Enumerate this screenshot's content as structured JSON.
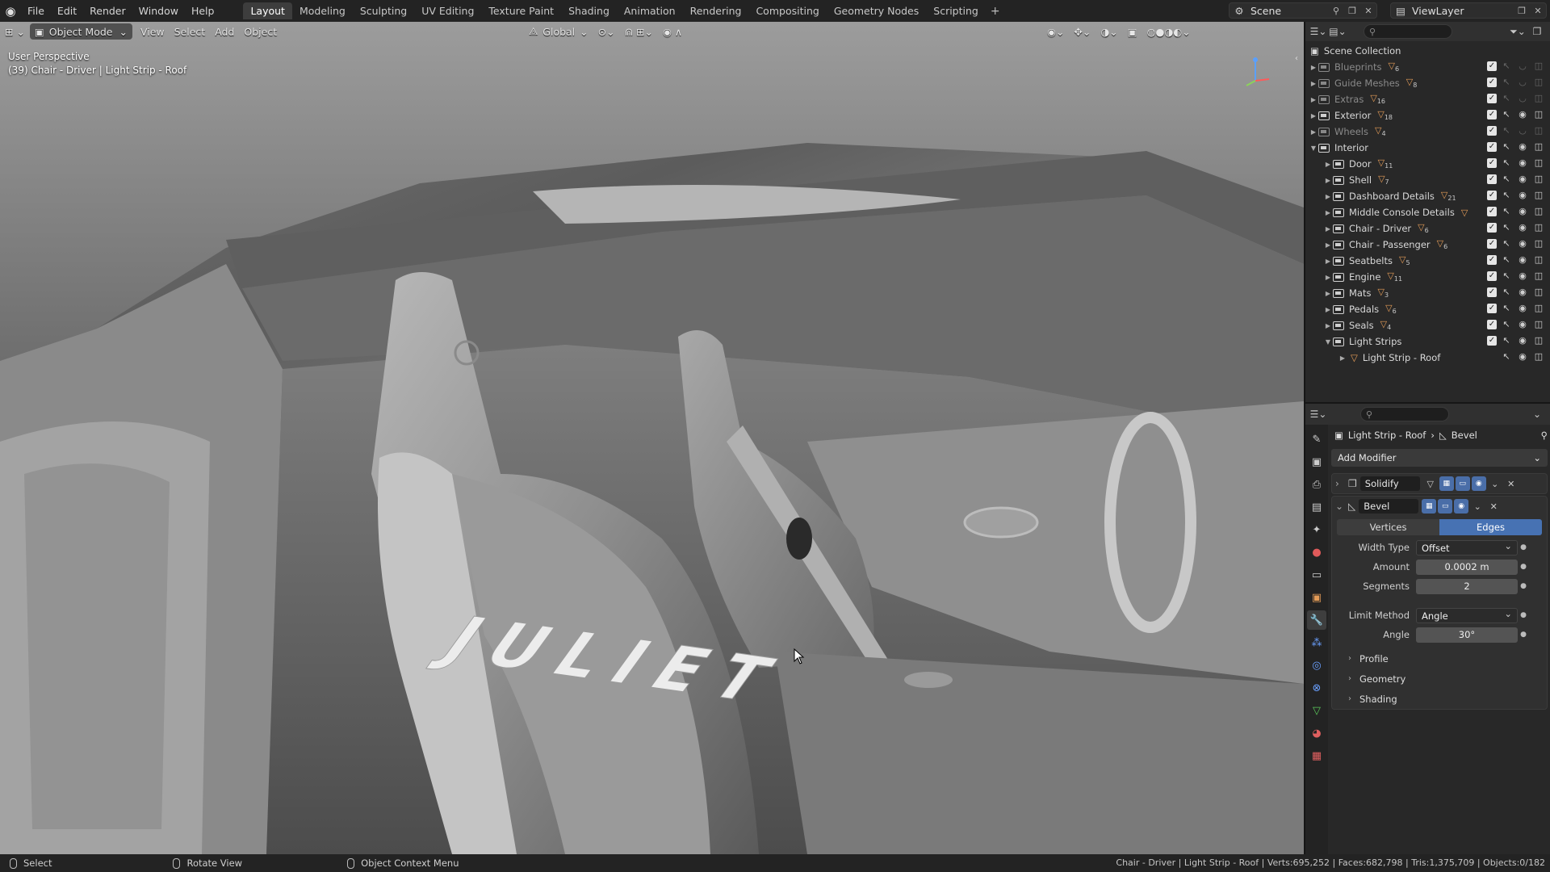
{
  "menu": [
    "File",
    "Edit",
    "Render",
    "Window",
    "Help"
  ],
  "workspaces": [
    "Layout",
    "Modeling",
    "Sculpting",
    "UV Editing",
    "Texture Paint",
    "Shading",
    "Animation",
    "Rendering",
    "Compositing",
    "Geometry Nodes",
    "Scripting"
  ],
  "active_workspace": "Layout",
  "scene": "Scene",
  "view_layer": "ViewLayer",
  "viewport": {
    "mode": "Object Mode",
    "menus": [
      "View",
      "Select",
      "Add",
      "Object"
    ],
    "orientation": "Global",
    "perspective": "User Perspective",
    "active_info": "(39) Chair - Driver | Light Strip - Roof",
    "model_text": "JULIET"
  },
  "outliner": {
    "root": "Scene Collection",
    "rows": [
      {
        "name": "Blueprints",
        "count": "6",
        "dim": true,
        "level": 0
      },
      {
        "name": "Guide Meshes",
        "count": "8",
        "dim": true,
        "level": 0
      },
      {
        "name": "Extras",
        "count": "16",
        "dim": true,
        "level": 0
      },
      {
        "name": "Exterior",
        "count": "18",
        "dim": false,
        "level": 0
      },
      {
        "name": "Wheels",
        "count": "4",
        "dim": true,
        "level": 0
      },
      {
        "name": "Interior",
        "count": "",
        "dim": false,
        "level": 0,
        "open": true
      },
      {
        "name": "Door",
        "count": "11",
        "dim": false,
        "level": 1
      },
      {
        "name": "Shell",
        "count": "7",
        "dim": false,
        "level": 1
      },
      {
        "name": "Dashboard Details",
        "count": "21",
        "dim": false,
        "level": 1
      },
      {
        "name": "Middle Console Details",
        "count": "",
        "dim": false,
        "level": 1
      },
      {
        "name": "Chair - Driver",
        "count": "6",
        "dim": false,
        "level": 1
      },
      {
        "name": "Chair - Passenger",
        "count": "6",
        "dim": false,
        "level": 1
      },
      {
        "name": "Seatbelts",
        "count": "5",
        "dim": false,
        "level": 1
      },
      {
        "name": "Engine",
        "count": "11",
        "dim": false,
        "level": 1
      },
      {
        "name": "Mats",
        "count": "3",
        "dim": false,
        "level": 1
      },
      {
        "name": "Pedals",
        "count": "6",
        "dim": false,
        "level": 1
      },
      {
        "name": "Seals",
        "count": "4",
        "dim": false,
        "level": 1
      },
      {
        "name": "Light Strips",
        "count": "",
        "dim": false,
        "level": 1,
        "open": true
      },
      {
        "name": "Light Strip - Roof",
        "count": "",
        "dim": false,
        "level": 2,
        "object": true
      }
    ]
  },
  "properties": {
    "object": "Light Strip - Roof",
    "modifier_crumb": "Bevel",
    "add_modifier": "Add Modifier",
    "solidify": "Solidify",
    "bevel": {
      "name": "Bevel",
      "affect_vertices": "Vertices",
      "affect_edges": "Edges",
      "width_type_label": "Width Type",
      "width_type": "Offset",
      "amount_label": "Amount",
      "amount": "0.0002 m",
      "segments_label": "Segments",
      "segments": "2",
      "limit_method_label": "Limit Method",
      "limit_method": "Angle",
      "angle_label": "Angle",
      "angle": "30°",
      "subpanels": [
        "Profile",
        "Geometry",
        "Shading"
      ]
    }
  },
  "status": {
    "select": "Select",
    "rotate": "Rotate View",
    "context": "Object Context Menu",
    "stats": "Chair - Driver | Light Strip - Roof | Verts:695,252 | Faces:682,798 | Tris:1,375,709 | Objects:0/182"
  }
}
